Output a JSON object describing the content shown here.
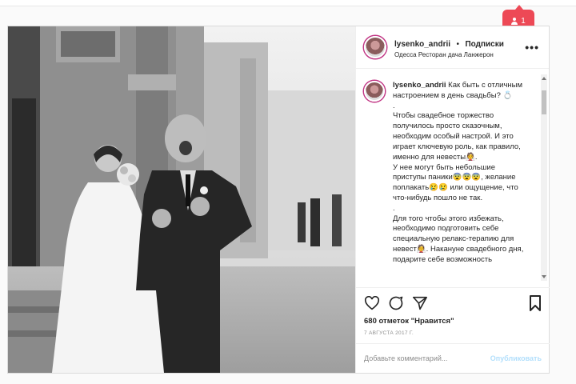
{
  "notification": {
    "count": "1",
    "icon": "person-icon",
    "color": "#ed4956"
  },
  "post": {
    "header": {
      "username": "lysenko_andrii",
      "separator": "•",
      "follow_label": "Подписки",
      "location": "Одесса Ресторан дача Ланжерон",
      "more_label": "•••"
    },
    "caption": {
      "username": "lysenko_andrii",
      "paragraphs": [
        "Как быть с отличным настроением в день свадьбы? 💍",
        ".",
        "Чтобы свадебное торжество получилось просто сказочным, необходим особый настрой. И это играет ключевую роль, как правило, именно для невесты👰.",
        "У нее могут быть небольшие приступы паники😨😨😨, желание поплакать😢😢 или ощущение, что что-нибудь пошло не так.",
        ".",
        "Для того чтобы этого избежать, необходимо подготовить себе специальную релакс-терапию для невест👰. Накануне свадебного дня, подарите себе возможность"
      ]
    },
    "likes": "680 отметок \"Нравится\"",
    "date": "7 АВГУСТА 2017 Г.",
    "comment_placeholder": "Добавьте комментарий...",
    "publish_label": "Опубликовать"
  }
}
